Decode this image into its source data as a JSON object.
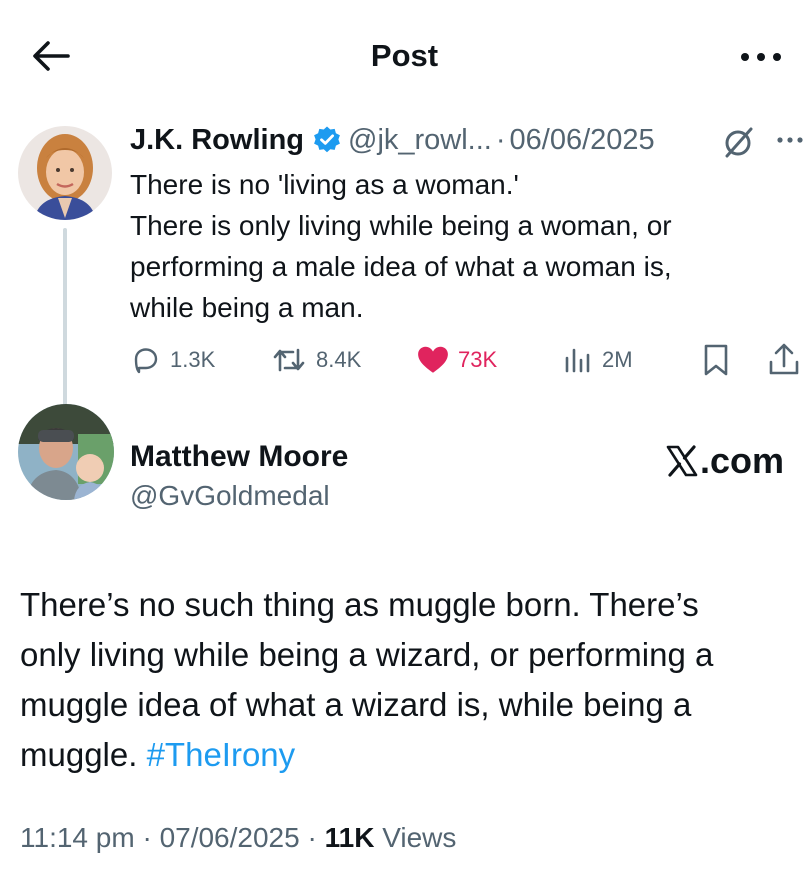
{
  "header": {
    "title": "Post",
    "back_icon": "arrow-left-icon",
    "more_icon": "more-horizontal-icon"
  },
  "parent_post": {
    "author_name": "J.K. Rowling",
    "handle": "@jk_rowl...",
    "separator": "·",
    "date": "06/06/2025",
    "lines": [
      "There is no 'living as a woman.'",
      "There is only living while being a woman, or",
      "performing a male idea of what a woman is,",
      "while being a man."
    ],
    "stats": {
      "replies": "1.3K",
      "reposts": "8.4K",
      "likes": "73K",
      "views": "2M"
    },
    "accent_like": "#e0245e",
    "verified_color": "#1d9bf0"
  },
  "post": {
    "author_name": "Matthew Moore",
    "handle": "@GvGoldmedal",
    "watermark": ".com",
    "lines": [
      "There’s no such thing as muggle born. There’s",
      "only living while being a wizard, or performing a",
      "muggle idea of what a wizard is, while being a"
    ],
    "last_line_text": "muggle.",
    "hashtag": "#TheIrony",
    "time": "11:14 pm",
    "separator": "·",
    "date": "07/06/2025",
    "views_count": "11K",
    "views_label": "Views"
  }
}
